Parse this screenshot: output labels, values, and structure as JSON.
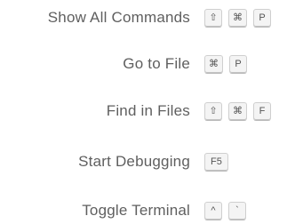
{
  "hints": [
    {
      "label": "Show All Commands",
      "keys": [
        "⇧",
        "⌘",
        "P"
      ]
    },
    {
      "label": "Go to File",
      "keys": [
        "⌘",
        "P"
      ]
    },
    {
      "label": "Find in Files",
      "keys": [
        "⇧",
        "⌘",
        "F"
      ]
    },
    {
      "label": "Start Debugging",
      "keys": [
        "F5"
      ]
    },
    {
      "label": "Toggle Terminal",
      "keys": [
        "^",
        "`"
      ]
    }
  ]
}
